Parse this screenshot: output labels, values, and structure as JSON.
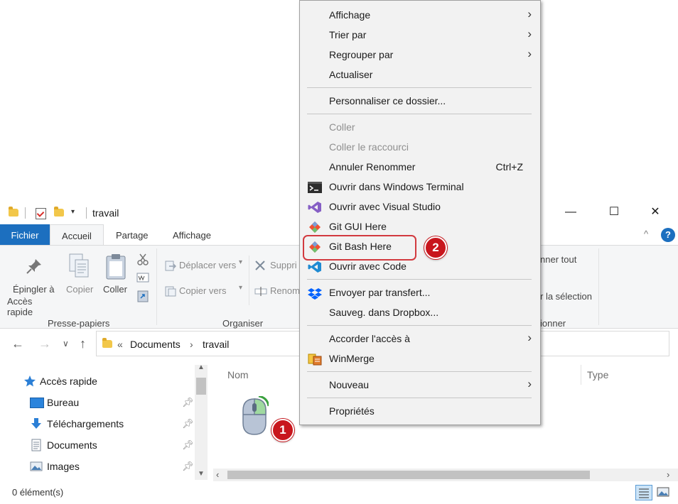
{
  "window": {
    "title": "travail",
    "controls": {
      "minimize": "—",
      "maximize": "☐",
      "close": "✕"
    },
    "qa_dropdown": "▾"
  },
  "ribbon": {
    "tabs": [
      "Fichier",
      "Accueil",
      "Partage",
      "Affichage"
    ],
    "collapse": "^",
    "help": "?",
    "clipboard": {
      "pin_line1": "Épingler à",
      "pin_line2": "Accès rapide",
      "copy": "Copier",
      "paste": "Coller",
      "group": "Presse-papiers"
    },
    "organize": {
      "move_to": "Déplacer vers",
      "copy_to": "Copier vers",
      "delete": "Suppri",
      "rename": "Renom",
      "group": "Organiser"
    },
    "select": {
      "select_all": "nner tout",
      "invert": "r la sélection",
      "group": "ionner"
    }
  },
  "address": {
    "chevrons": "«",
    "parts": [
      "Documents",
      "travail"
    ],
    "separator": "›"
  },
  "nav_pane": {
    "quick_access": "Accès rapide",
    "items": [
      "Bureau",
      "Téléchargements",
      "Documents",
      "Images"
    ]
  },
  "content": {
    "columns": [
      "Nom",
      "Type"
    ]
  },
  "status": {
    "count": "0 élément(s)"
  },
  "annotations": {
    "badge1": "1",
    "badge2": "2"
  },
  "context_menu": {
    "items": [
      {
        "label": "Affichage",
        "submenu": true
      },
      {
        "label": "Trier par",
        "submenu": true
      },
      {
        "label": "Regrouper par",
        "submenu": true
      },
      {
        "label": "Actualiser"
      },
      {
        "label": "Personnaliser ce dossier..."
      },
      {
        "label": "Coller",
        "disabled": true
      },
      {
        "label": "Coller le raccourci",
        "disabled": true
      },
      {
        "label": "Annuler Renommer",
        "shortcut": "Ctrl+Z"
      },
      {
        "label": "Ouvrir dans Windows Terminal",
        "icon": "terminal-icon"
      },
      {
        "label": "Ouvrir avec Visual Studio",
        "icon": "visual-studio-icon"
      },
      {
        "label": "Git GUI Here",
        "icon": "git-icon"
      },
      {
        "label": "Git Bash Here",
        "icon": "git-icon"
      },
      {
        "label": "Ouvrir avec Code",
        "icon": "vscode-icon"
      },
      {
        "label": "Envoyer par transfert...",
        "icon": "dropbox-icon"
      },
      {
        "label": "Sauveg. dans Dropbox..."
      },
      {
        "label": "Accorder l'accès à",
        "submenu": true
      },
      {
        "label": "WinMerge",
        "icon": "winmerge-icon"
      },
      {
        "label": "Nouveau",
        "submenu": true
      },
      {
        "label": "Propriétés"
      }
    ],
    "arrow": "›"
  },
  "colors": {
    "accent": "#1c6fbf",
    "badge": "#c8161d",
    "highlight_border": "#d23a3f"
  }
}
